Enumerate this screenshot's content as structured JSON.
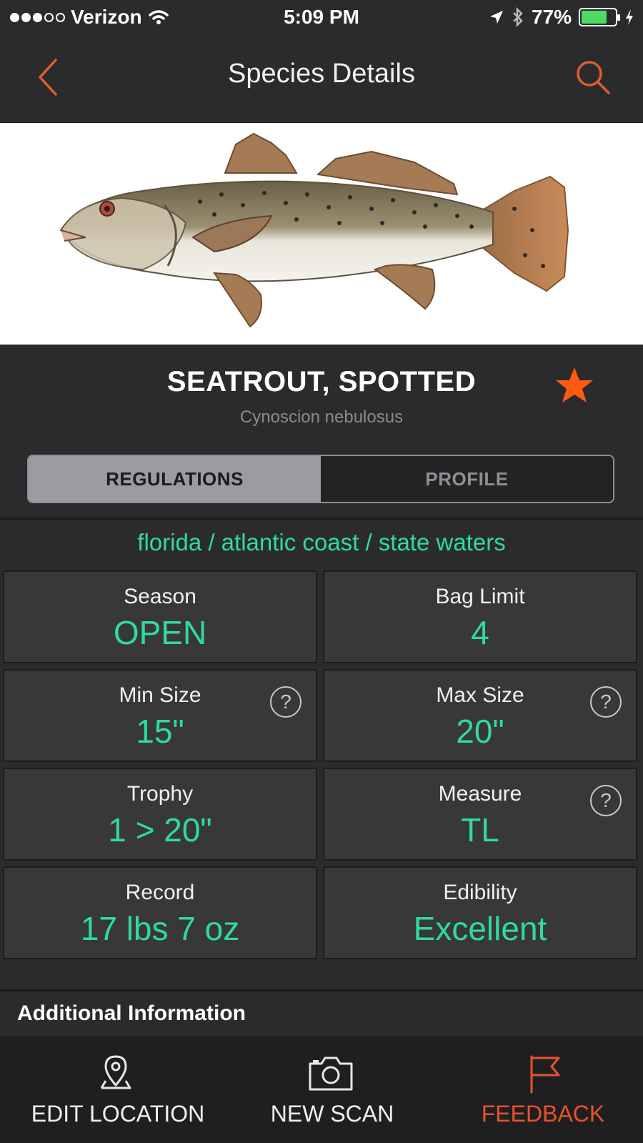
{
  "status_bar": {
    "carrier": "Verizon",
    "time": "5:09 PM",
    "battery": "77%",
    "battery_fraction": 0.77,
    "icons": [
      "signal-icon",
      "wifi-icon",
      "location-arrow-icon",
      "bluetooth-icon",
      "battery-icon",
      "charging-icon"
    ]
  },
  "nav": {
    "title": "Species Details",
    "back_icon": "chevron-left-icon",
    "search_icon": "search-icon",
    "accent_color": "#e8622a"
  },
  "species": {
    "name": "SEATROUT, SPOTTED",
    "scientific_name": "Cynoscion nebulosus",
    "favorite_icon": "star-icon",
    "favorite_color": "#ff5a14"
  },
  "tabs": [
    {
      "label": "REGULATIONS",
      "active": true
    },
    {
      "label": "PROFILE",
      "active": false
    }
  ],
  "location": "florida / atlantic coast / state waters",
  "regulations": [
    {
      "label": "Season",
      "value": "OPEN",
      "help": false
    },
    {
      "label": "Bag Limit",
      "value": "4",
      "help": false
    },
    {
      "label": "Min Size",
      "value": "15\"",
      "help": true
    },
    {
      "label": "Max Size",
      "value": "20\"",
      "help": true
    },
    {
      "label": "Trophy",
      "value": "1 > 20\"",
      "help": false
    },
    {
      "label": "Measure",
      "value": "TL",
      "help": true
    },
    {
      "label": "Record",
      "value": "17 lbs 7 oz",
      "help": false
    },
    {
      "label": "Edibility",
      "value": "Excellent",
      "help": false
    }
  ],
  "help_symbol": "?",
  "additional_info": {
    "label": "Additional Information"
  },
  "tab_bar": [
    {
      "label": "EDIT LOCATION",
      "icon": "map-pin-icon"
    },
    {
      "label": "NEW SCAN",
      "icon": "camera-icon"
    },
    {
      "label": "FEEDBACK",
      "icon": "flag-icon",
      "color": "#e8522a"
    }
  ],
  "colors": {
    "value_green": "#2edb9c",
    "background": "#2b2b2e"
  }
}
